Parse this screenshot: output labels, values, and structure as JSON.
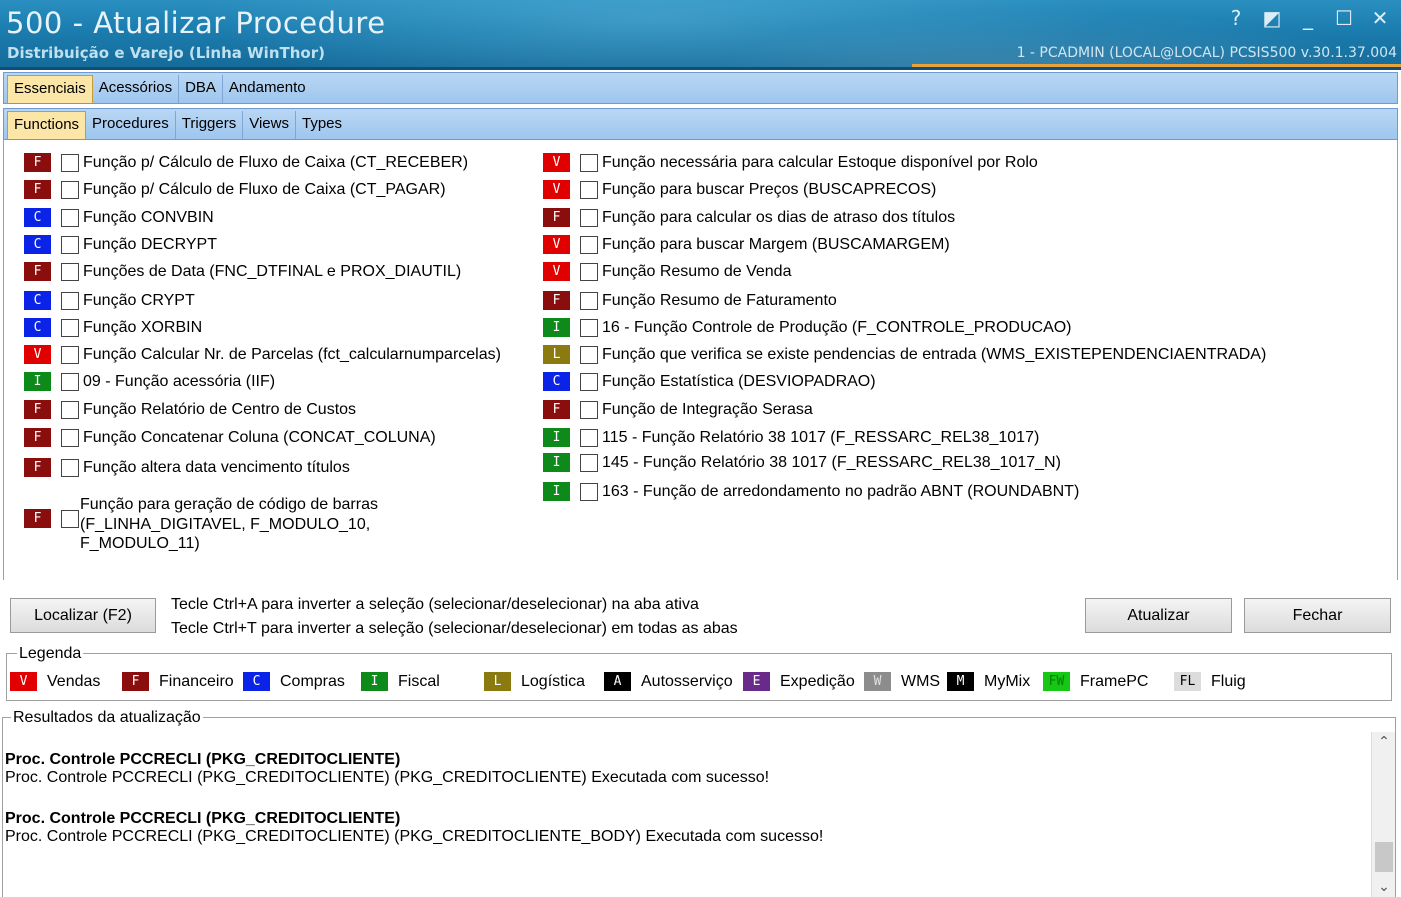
{
  "window": {
    "title": "500 - Atualizar Procedure",
    "subtitle": "Distribuição e Varejo (Linha WinThor)",
    "status": "1 - PCADMIN (LOCAL@LOCAL)   PCSIS500  v.30.1.37.004",
    "controls": {
      "help": "?",
      "restore_alt": "◩",
      "minimize": "_",
      "maximize": "☐",
      "close": "✕"
    }
  },
  "tabs_main": [
    "Essenciais",
    "Acessórios",
    "DBA",
    "Andamento"
  ],
  "tabs_sub": [
    "Functions",
    "Procedures",
    "Triggers",
    "Views",
    "Types"
  ],
  "colors": {
    "V": "#e00000",
    "F": "#8a0e0e",
    "C": "#0a23e6",
    "I": "#0d8a1a",
    "L": "#8a7a10",
    "A": "#000000",
    "E": "#6a2a8a",
    "W": "#8c8c8c",
    "M": "#000000",
    "FW": "#14c814",
    "FL": "#dcdcdc"
  },
  "left_items": [
    {
      "badge": "F",
      "label": "Função p/ Cálculo de Fluxo de Caixa (CT_RECEBER)"
    },
    {
      "badge": "F",
      "label": "Função p/ Cálculo de Fluxo de Caixa (CT_PAGAR)"
    },
    {
      "badge": "C",
      "label": "Função CONVBIN"
    },
    {
      "badge": "C",
      "label": "Função DECRYPT"
    },
    {
      "badge": "F",
      "label": "Funções de Data (FNC_DTFINAL e PROX_DIAUTIL)"
    },
    {
      "badge": "C",
      "label": "Função CRYPT"
    },
    {
      "badge": "C",
      "label": "Função XORBIN"
    },
    {
      "badge": "V",
      "label": "Função Calcular Nr. de Parcelas (fct_calcularnumparcelas)"
    },
    {
      "badge": "I",
      "label": "09 - Função acessória (IIF)"
    },
    {
      "badge": "F",
      "label": "Função Relatório de Centro de Custos"
    },
    {
      "badge": "F",
      "label": "Função Concatenar Coluna (CONCAT_COLUNA)"
    },
    {
      "badge": "F",
      "label": "Função altera data vencimento títulos"
    }
  ],
  "multi_item": {
    "badge": "F",
    "line1": "Função para geração de código de barras",
    "line2": "(F_LINHA_DIGITAVEL, F_MODULO_10,",
    "line3": "F_MODULO_11)"
  },
  "right_items": [
    {
      "badge": "V",
      "label": "Função necessária para calcular Estoque disponível por Rolo"
    },
    {
      "badge": "V",
      "label": "Função para buscar Preços (BUSCAPRECOS)"
    },
    {
      "badge": "F",
      "label": "Função para calcular os dias de atraso dos títulos"
    },
    {
      "badge": "V",
      "label": "Função para buscar Margem (BUSCAMARGEM)"
    },
    {
      "badge": "V",
      "label": "Função Resumo de Venda"
    },
    {
      "badge": "F",
      "label": "Função Resumo de Faturamento"
    },
    {
      "badge": "I",
      "label": "16 - Função Controle de Produção (F_CONTROLE_PRODUCAO)"
    },
    {
      "badge": "L",
      "label": "Função que verifica se existe pendencias de entrada (WMS_EXISTEPENDENCIAENTRADA)"
    },
    {
      "badge": "C",
      "label": "Função Estatística (DESVIOPADRAO)"
    },
    {
      "badge": "F",
      "label": "Função de Integração Serasa"
    },
    {
      "badge": "I",
      "label": "115 - Função Relatório 38 1017 (F_RESSARC_REL38_1017)"
    },
    {
      "badge": "I",
      "label": "145 - Função Relatório 38 1017 (F_RESSARC_REL38_1017_N)"
    },
    {
      "badge": "I",
      "label": "163 - Função de arredondamento no padrão ABNT (ROUNDABNT)"
    }
  ],
  "buttons": {
    "localizar": "Localizar (F2)",
    "atualizar": "Atualizar",
    "fechar": "Fechar"
  },
  "hints": [
    "Tecle Ctrl+A para inverter a seleção (selecionar/deselecionar) na aba ativa",
    "Tecle Ctrl+T para inverter a seleção (selecionar/deselecionar) em todas as abas"
  ],
  "legend": {
    "title": "Legenda",
    "items": [
      {
        "badge": "V",
        "label": "Vendas"
      },
      {
        "badge": "F",
        "label": "Financeiro"
      },
      {
        "badge": "C",
        "label": "Compras"
      },
      {
        "badge": "I",
        "label": "Fiscal"
      },
      {
        "badge": "L",
        "label": "Logística"
      },
      {
        "badge": "A",
        "label": "Autosserviço"
      },
      {
        "badge": "E",
        "label": "Expedição"
      },
      {
        "badge": "W",
        "label": "WMS"
      },
      {
        "badge": "M",
        "label": "MyMix"
      },
      {
        "badge": "FW",
        "label": "FramePC"
      },
      {
        "badge": "FL",
        "label": "Fluig"
      }
    ]
  },
  "results": {
    "title": "Resultados da atualização",
    "entries": [
      {
        "head": "Proc. Controle PCCRECLI (PKG_CREDITOCLIENTE)",
        "detail": "Proc. Controle PCCRECLI (PKG_CREDITOCLIENTE) (PKG_CREDITOCLIENTE) Executada com sucesso!"
      },
      {
        "head": "Proc. Controle PCCRECLI (PKG_CREDITOCLIENTE)",
        "detail": "Proc. Controle PCCRECLI (PKG_CREDITOCLIENTE) (PKG_CREDITOCLIENTE_BODY) Executada com sucesso!"
      }
    ],
    "scroll_up": "⌃",
    "scroll_down": "⌄"
  }
}
